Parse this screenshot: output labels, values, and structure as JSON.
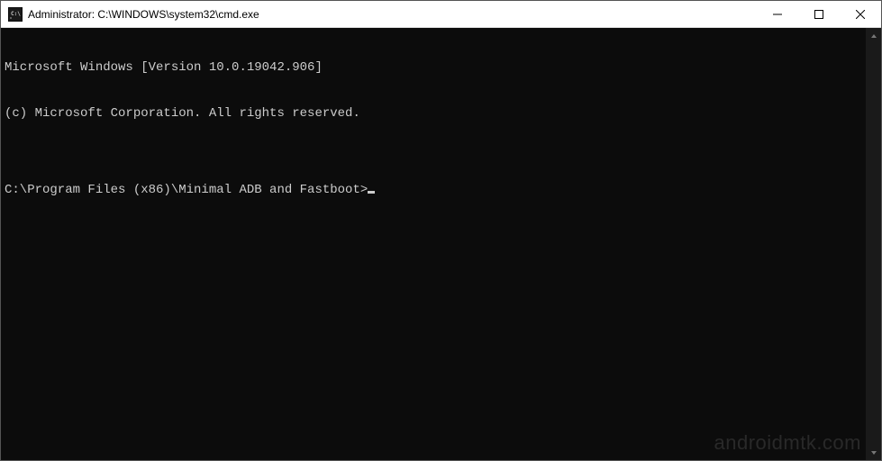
{
  "window": {
    "title": "Administrator: C:\\WINDOWS\\system32\\cmd.exe"
  },
  "terminal": {
    "line1": "Microsoft Windows [Version 10.0.19042.906]",
    "line2": "(c) Microsoft Corporation. All rights reserved.",
    "blank": "",
    "prompt": "C:\\Program Files (x86)\\Minimal ADB and Fastboot>"
  },
  "watermark": "androidmtk.com"
}
